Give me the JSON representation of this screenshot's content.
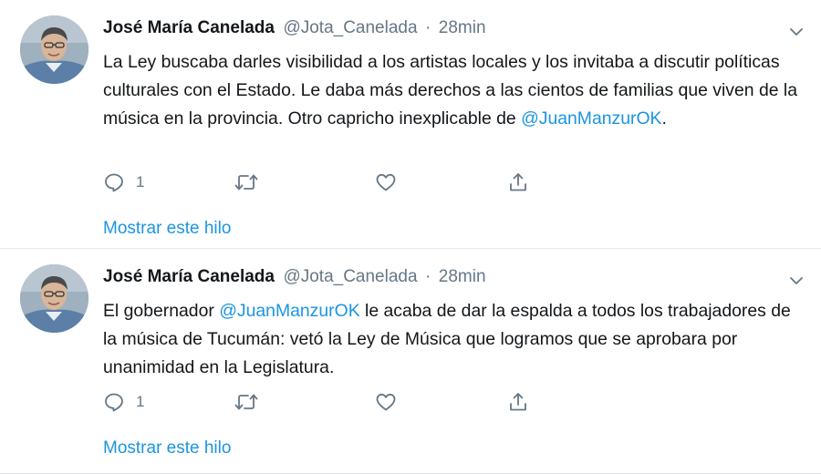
{
  "tweets": [
    {
      "author_name": "José María Canelada",
      "handle": "@Jota_Canelada",
      "separator": "·",
      "time": "28min",
      "text_before": "La Ley buscaba darles visibilidad a los artistas locales y los invitaba a discutir políticas culturales con el Estado. Le daba más derechos a las cientos de familias que viven de la música en la provincia. Otro capricho inexplicable de ",
      "mention": "@JuanManzurOK",
      "text_after": ".",
      "reply_count": "1",
      "show_thread": "Mostrar este hilo"
    },
    {
      "author_name": "José María Canelada",
      "handle": "@Jota_Canelada",
      "separator": "·",
      "time": "28min",
      "text_before": "El gobernador ",
      "mention": "@JuanManzurOK",
      "text_after": " le acaba de dar la espalda a todos los trabajadores de la música de Tucumán: vetó la Ley de Música que logramos que se aprobara por unanimidad en la Legislatura.",
      "reply_count": "1",
      "show_thread": "Mostrar este hilo"
    }
  ],
  "colors": {
    "link": "#1b95e0",
    "secondary_text": "#657786",
    "divider": "#e1e8ed"
  },
  "icons": [
    "reply-icon",
    "retweet-icon",
    "like-icon",
    "share-icon",
    "caret-down-icon"
  ]
}
